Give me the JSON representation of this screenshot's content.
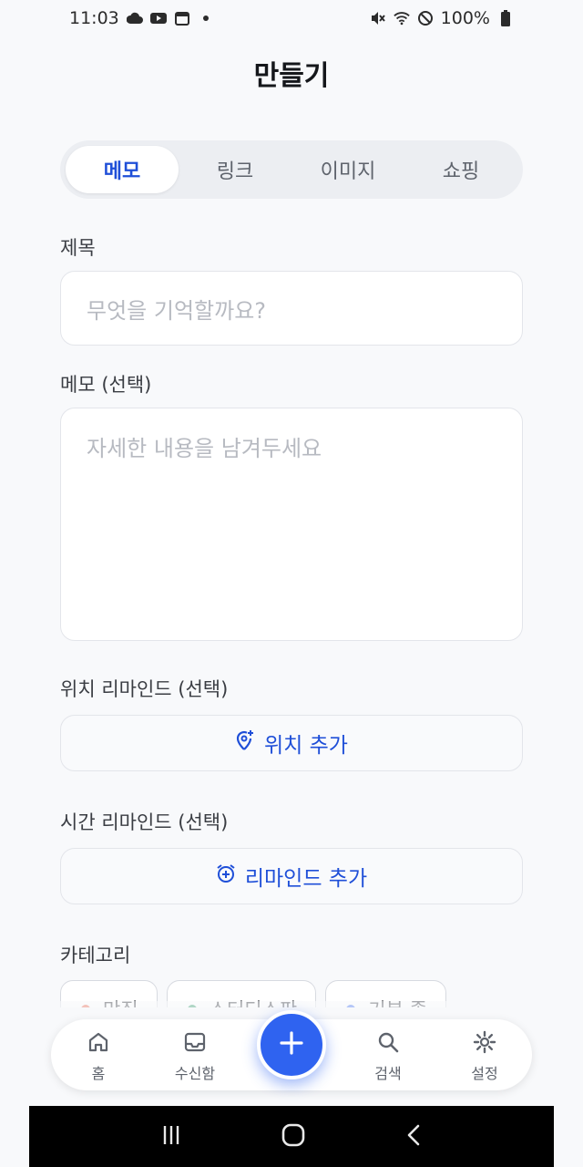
{
  "status_bar": {
    "time": "11:03",
    "left_icons": [
      "cloud-icon",
      "youtube-icon",
      "calendar-icon",
      "dot-icon"
    ],
    "right_icons": [
      "mute-icon",
      "wifi-icon",
      "dnd-icon",
      "battery-icon"
    ],
    "battery": "100%"
  },
  "header": {
    "title": "만들기"
  },
  "tabs": [
    {
      "label": "메모",
      "active": true
    },
    {
      "label": "링크",
      "active": false
    },
    {
      "label": "이미지",
      "active": false
    },
    {
      "label": "쇼핑",
      "active": false
    }
  ],
  "form": {
    "title_label": "제목",
    "title_placeholder": "무엇을 기억할까요?",
    "memo_label": "메모 (선택)",
    "memo_placeholder": "자세한 내용을 남겨두세요",
    "location_label": "위치 리마인드 (선택)",
    "location_button": "위치 추가",
    "time_label": "시간 리마인드 (선택)",
    "time_button": "리마인드 추가",
    "category_label": "카테고리"
  },
  "categories": [
    {
      "label": "맛집",
      "color": "#e8553a"
    },
    {
      "label": "스터디스팟",
      "color": "#1f8f5b"
    },
    {
      "label": "기분 좋",
      "color": "#2f63f0"
    }
  ],
  "bottom_nav": {
    "home": "홈",
    "inbox": "수신함",
    "search": "검색",
    "settings": "설정"
  },
  "colors": {
    "accent": "#1f4fd8",
    "fab": "#2f63f0",
    "background": "#f8f9fb"
  }
}
